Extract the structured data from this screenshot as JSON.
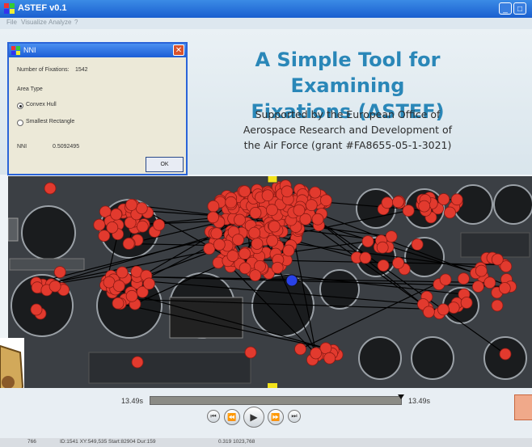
{
  "window": {
    "title": "ASTEF v0.1"
  },
  "menu": [
    "File",
    "Visualize",
    "Analyze",
    "?"
  ],
  "banner": {
    "title_line1": "A Simple Tool for Examining",
    "title_line2": "Fixations (ASTEF)",
    "sub_line1": "Supported by the European Office of",
    "sub_line2": "Aerospace Research and Development of",
    "sub_line3": "the Air Force (grant #FA8655-05-1-3021)"
  },
  "dialog": {
    "title": "NNI",
    "fixations_label": "Number of Fixations:",
    "fixations_value": "1542",
    "area_type_label": "Area Type",
    "opt_convex": "Convex Hull",
    "opt_rect": "Smallest Rectangle",
    "nni_label": "NNI",
    "nni_value": "0.5092495",
    "ok": "OK"
  },
  "player": {
    "time_left": "13.49s",
    "time_right": "13.49s"
  },
  "status": {
    "s1": "766",
    "s2": "ID:1541 XY:549,535 Start:82904 Dur:159",
    "s3": "0.319 1023,768"
  },
  "colors": {
    "fixation": "#e23a2e",
    "highlight": "#2942e8",
    "accent": "#2a87b8",
    "marker": "#f2e21a"
  }
}
